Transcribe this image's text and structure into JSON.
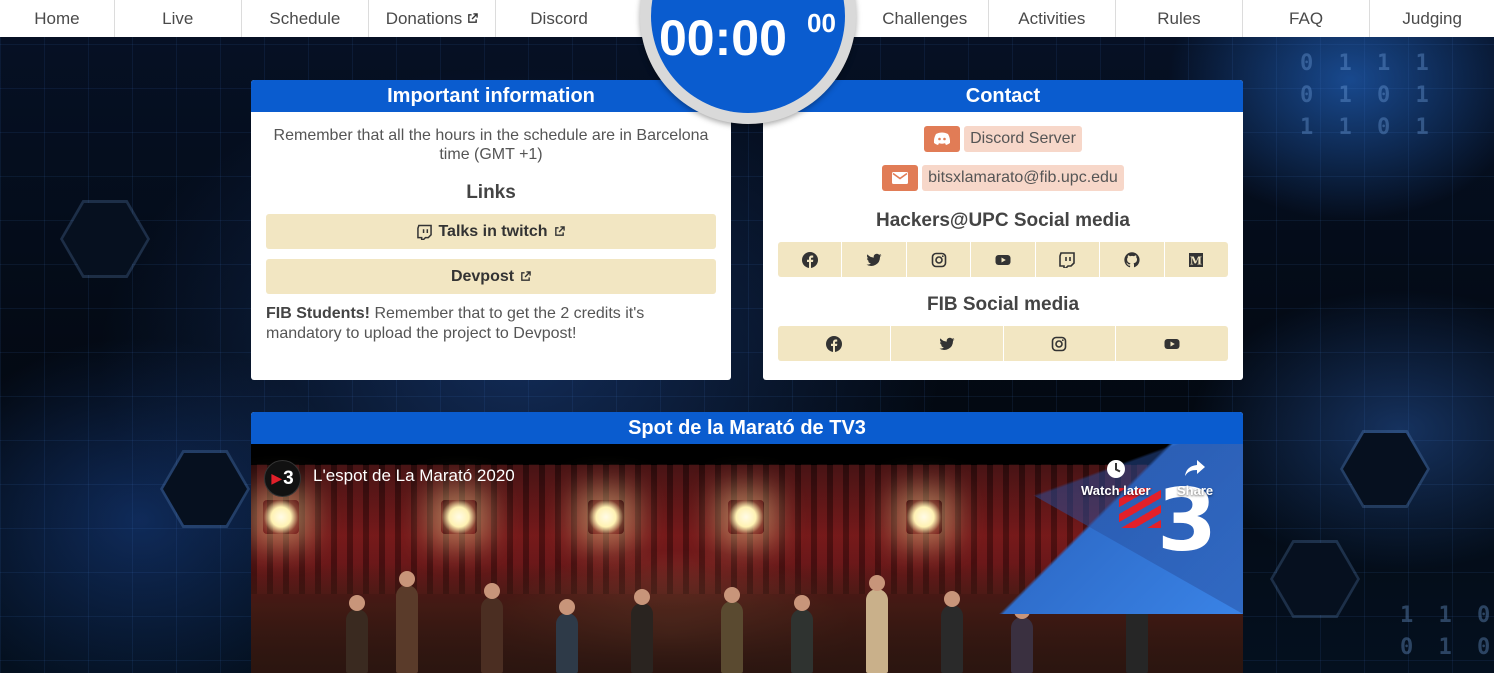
{
  "nav": {
    "items": [
      {
        "label": "Home"
      },
      {
        "label": "Live"
      },
      {
        "label": "Schedule"
      },
      {
        "label": "Donations",
        "external": true
      },
      {
        "label": "Discord"
      },
      {
        "label": "Challenges"
      },
      {
        "label": "Activities"
      },
      {
        "label": "Rules"
      },
      {
        "label": "FAQ"
      },
      {
        "label": "Judging"
      }
    ]
  },
  "timer": {
    "main": "00:00",
    "seconds": "00"
  },
  "info": {
    "title": "Important information",
    "text": "Remember that all the hours in the schedule are in Barcelona time (GMT +1)",
    "links_title": "Links",
    "link_twitch": "Talks in twitch",
    "link_devpost": "Devpost",
    "fib_bold": "FIB Students!",
    "fib_text": " Remember that to get the 2 credits it's mandatory to upload the project to Devpost!"
  },
  "contact": {
    "title": "Contact",
    "discord_label": "Discord Server",
    "email_label": "bitsxlamarato@fib.upc.edu",
    "hackers_title": "Hackers@UPC Social media",
    "hackers_icons": [
      "facebook-icon",
      "twitter-icon",
      "instagram-icon",
      "youtube-icon",
      "twitch-icon",
      "github-icon",
      "medium-icon"
    ],
    "fib_title": "FIB Social media",
    "fib_icons": [
      "facebook-icon",
      "twitter-icon",
      "instagram-icon",
      "youtube-icon"
    ]
  },
  "video": {
    "section_title": "Spot de la Marató de TV3",
    "video_title": "L'espot de La Marató 2020",
    "watch_later": "Watch later",
    "share": "Share",
    "channel_logo": "3",
    "corner_logo": "3"
  },
  "colors": {
    "accent_blue": "#0a5ccf",
    "button_beige": "#f2e6c2",
    "contact_orange": "#e17c56",
    "contact_peach": "#f7d7c9"
  }
}
